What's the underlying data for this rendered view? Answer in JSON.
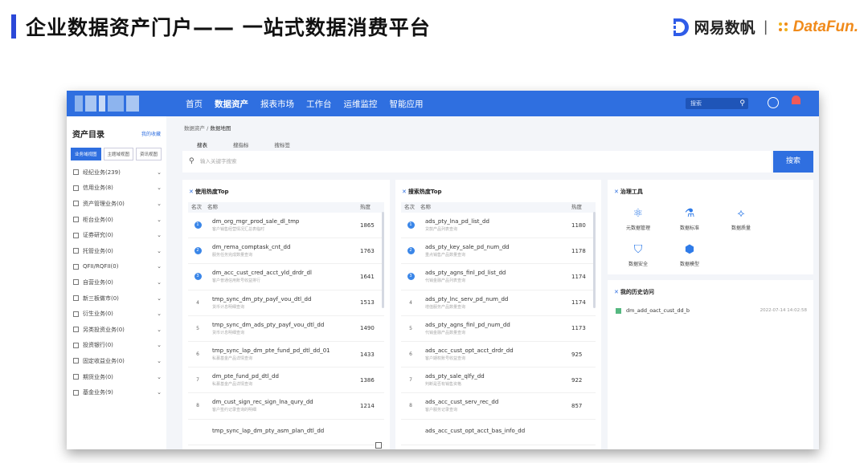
{
  "slide": {
    "title": "企业数据资产门户—— 一站式数据消费平台",
    "brand_netease": "网易数帆",
    "brand_sep": "|",
    "brand_datafun": "DataFun.",
    "accent": "#2b48d8"
  },
  "topnav": {
    "items": [
      "首页",
      "数据资产",
      "报表市场",
      "工作台",
      "运维监控",
      "智能应用"
    ],
    "active_index": 1,
    "search_placeholder": "搜索",
    "color": "#2f6fe0"
  },
  "sidebar": {
    "title": "资产目录",
    "fav": "我的收藏",
    "tabs": [
      "业务域视图",
      "主题域视图",
      "资讯视图"
    ],
    "items": [
      "经纪业务(239)",
      "信用业务(8)",
      "资产管理业务(0)",
      "柜台业务(0)",
      "证券研究(0)",
      "托管业务(0)",
      "QFII/RQFII(0)",
      "自营业务(0)",
      "新三板做市(0)",
      "衍生业务(0)",
      "另类投资业务(0)",
      "投资银行(0)",
      "固定收益业务(0)",
      "期货业务(0)",
      "基金业务(9)"
    ]
  },
  "main": {
    "crumb_root": "数据资产",
    "crumb_sep": "/",
    "crumb_current": "数据地图",
    "subtabs": [
      "搜表",
      "搜指标",
      "搜标签"
    ],
    "search_placeholder": "输入关键字搜索",
    "search_button": "搜索"
  },
  "usage_panel": {
    "title": "使用热度Top",
    "headers": [
      "名次",
      "名称",
      "热度"
    ],
    "rows": [
      {
        "rank": "1",
        "name": "dm_org_mgr_prod_sale_dl_tmp",
        "desc": "客户销售经营情况汇总表临时",
        "heat": "1865"
      },
      {
        "rank": "2",
        "name": "dm_rema_comptask_cnt_dd",
        "desc": "服务任务完成数量查询",
        "heat": "1763"
      },
      {
        "rank": "3",
        "name": "dm_acc_cust_cred_acct_yld_drdr_dl",
        "desc": "客户普通信用账号收益排行",
        "heat": "1641"
      },
      {
        "rank": "4",
        "name": "tmp_sync_dm_pty_payf_vou_dtl_dd",
        "desc": "货币计息明细查询",
        "heat": "1513"
      },
      {
        "rank": "5",
        "name": "tmp_sync_dm_ads_pty_payf_vou_dtl_dd",
        "desc": "货币计息明细查询",
        "heat": "1490"
      },
      {
        "rank": "6",
        "name": "tmp_sync_lap_dm_pte_fund_pd_dtl_dd_01",
        "desc": "私募基金产品详情查询",
        "heat": "1433"
      },
      {
        "rank": "7",
        "name": "dm_pte_fund_pd_dtl_dd",
        "desc": "私募基金产品详情查询",
        "heat": "1386"
      },
      {
        "rank": "8",
        "name": "dm_cust_sign_rec_sign_lna_qury_dd",
        "desc": "客户签约记录查询的明细",
        "heat": "1214"
      },
      {
        "rank": "",
        "name": "tmp_sync_lap_dm_pty_asm_plan_dtl_dd",
        "desc": "",
        "heat": ""
      }
    ]
  },
  "search_panel": {
    "title": "搜索热度Top",
    "headers": [
      "名次",
      "名称",
      "热度"
    ],
    "rows": [
      {
        "rank": "1",
        "name": "ads_pty_lna_pd_list_dd",
        "desc": "贷款产品列表查询",
        "heat": "1180"
      },
      {
        "rank": "2",
        "name": "ads_pty_key_sale_pd_num_dd",
        "desc": "重点销售产品数量查询",
        "heat": "1178"
      },
      {
        "rank": "3",
        "name": "ads_pty_agns_finl_pd_list_dd",
        "desc": "代销金融产品列表查询",
        "heat": "1174"
      },
      {
        "rank": "4",
        "name": "ads_pty_lnc_serv_pd_num_dd",
        "desc": "增值服务产品数量查询",
        "heat": "1174"
      },
      {
        "rank": "5",
        "name": "ads_pty_agns_finl_pd_num_dd",
        "desc": "代销金融产品数量查询",
        "heat": "1173"
      },
      {
        "rank": "6",
        "name": "ads_acc_cust_opt_acct_drdr_dd",
        "desc": "客户期权账号收益查询",
        "heat": "925"
      },
      {
        "rank": "7",
        "name": "ads_pty_sale_qlfy_dd",
        "desc": "判断是否有销售资格",
        "heat": "922"
      },
      {
        "rank": "8",
        "name": "ads_acc_cust_serv_rec_dd",
        "desc": "客户服务记录查询",
        "heat": "857"
      },
      {
        "rank": "",
        "name": "ads_acc_cust_opt_acct_bas_info_dd",
        "desc": "",
        "heat": ""
      }
    ]
  },
  "tools_panel": {
    "title": "治理工具",
    "tools": [
      {
        "label": "元数据管理",
        "icon": "atom-icon"
      },
      {
        "label": "数据标准",
        "icon": "flask-icon"
      },
      {
        "label": "数据质量",
        "icon": "network-icon"
      },
      {
        "label": "数据安全",
        "icon": "shield-icon"
      },
      {
        "label": "数据模型",
        "icon": "cube-icon"
      }
    ]
  },
  "history_panel": {
    "title": "我的历史访问",
    "items": [
      {
        "name": "dm_add_oact_cust_dd_b",
        "time": "2022-07-14 14:02:58"
      }
    ]
  }
}
